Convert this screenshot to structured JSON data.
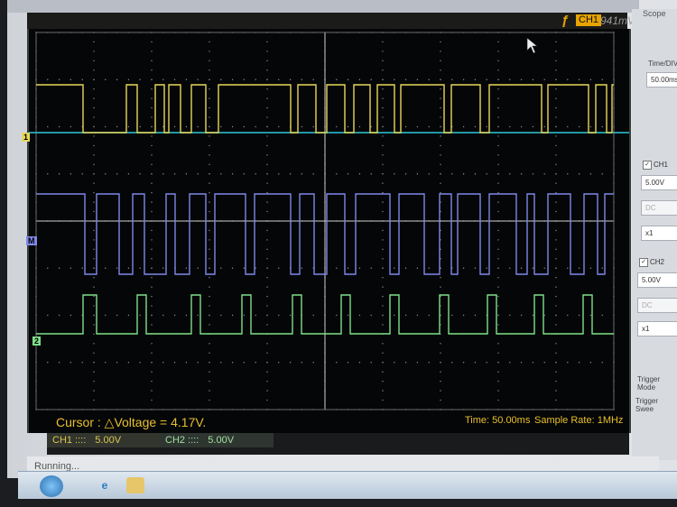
{
  "window": {
    "panel_title": "Scope",
    "status": "Running..."
  },
  "trigger": {
    "edge_symbol": "ƒ",
    "channel": "CH1",
    "level": "941mV"
  },
  "markers": {
    "ch1": "1",
    "math": "M",
    "ch2": "2"
  },
  "readouts": {
    "cursor": "Cursor : △Voltage = 4.17V.",
    "time": "Time: 50.00ms",
    "sample_rate": "Sample Rate: 1MHz"
  },
  "channels": [
    {
      "label": "CH1 ::::",
      "scale": "5.00V"
    },
    {
      "label": "CH2 ::::",
      "scale": "5.00V"
    }
  ],
  "panel": {
    "time_div_label": "Time/DIV",
    "time_div_value": "50.00ms",
    "ch1_label": "CH1",
    "ch1_checked": true,
    "ch1_volts": "5.00V",
    "ch1_coupling": "DC",
    "ch1_probe": "x1",
    "ch2_label": "CH2",
    "ch2_checked": true,
    "ch2_volts": "5.00V",
    "ch2_coupling": "DC",
    "ch2_probe": "x1",
    "trigger_mode_label": "Trigger Mode",
    "trigger_sweep_label": "Trigger Swee"
  },
  "colors": {
    "ch1": "#e7d85a",
    "math": "#7f88e8",
    "ch2": "#7fe08b",
    "trigger_level": "#2fc9d8",
    "grid": "#8a8a8a",
    "readout": "#e8c030"
  },
  "icons": [
    "trigger-edge-icon",
    "start-orb-icon",
    "ie-icon",
    "folder-icon",
    "mouse-cursor-icon"
  ]
}
